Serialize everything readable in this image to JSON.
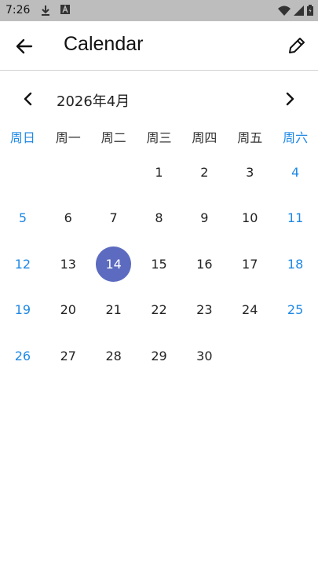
{
  "status": {
    "time": "7:26",
    "icons": [
      "download-icon",
      "a-badge-icon",
      "wifi-icon",
      "signal-icon",
      "battery-icon"
    ]
  },
  "appbar": {
    "title": "Calendar",
    "back_icon": "arrow-left-icon",
    "edit_icon": "pencil-icon"
  },
  "month": {
    "label": "2026年4月",
    "prev_icon": "chevron-left-icon",
    "next_icon": "chevron-right-icon"
  },
  "weekdays": [
    "周日",
    "周一",
    "周二",
    "周三",
    "周四",
    "周五",
    "周六"
  ],
  "calendar": {
    "leading_blanks": 3,
    "days": [
      "1",
      "2",
      "3",
      "4",
      "5",
      "6",
      "7",
      "8",
      "9",
      "10",
      "11",
      "12",
      "13",
      "14",
      "15",
      "16",
      "17",
      "18",
      "19",
      "20",
      "21",
      "22",
      "23",
      "24",
      "25",
      "26",
      "27",
      "28",
      "29",
      "30"
    ],
    "selected_day": "14"
  },
  "colors": {
    "weekend": "#1e88e5",
    "selected_circle": "#5c6bc0",
    "statusbar": "#bdbdbd"
  }
}
